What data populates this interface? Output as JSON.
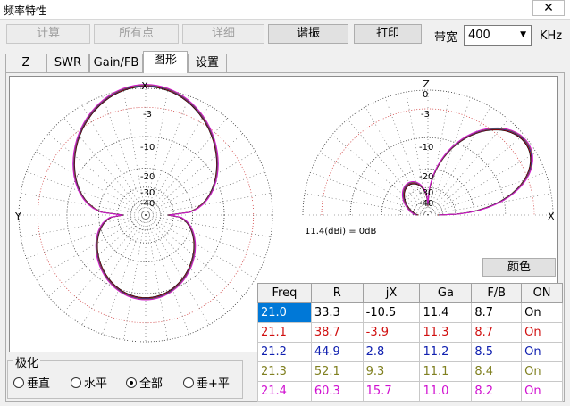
{
  "window": {
    "title": "频率特性",
    "close_glyph": "✕"
  },
  "toolbar": {
    "calc": "计算",
    "all_points": "所有点",
    "detail": "详细",
    "resonance": "谐振",
    "print": "打印",
    "bandwidth_label": "带宽",
    "bandwidth_value": "400",
    "unit": "KHz"
  },
  "tabs": [
    {
      "label": "Z"
    },
    {
      "label": "SWR"
    },
    {
      "label": "Gain/FB"
    },
    {
      "label": "图形",
      "active": true
    },
    {
      "label": "设置"
    }
  ],
  "plots": {
    "azimuth": {
      "top_label": "X",
      "left_label": "Y",
      "rings": [
        "-3",
        "-10",
        "-20",
        "-30",
        "-40"
      ]
    },
    "elevation": {
      "top_label": "Z",
      "right_label": "X",
      "rings": [
        "0",
        "-3",
        "-10",
        "-20",
        "-30",
        "-40"
      ],
      "gain_note": "11.4(dBi) = 0dB"
    }
  },
  "color_button": "颜色",
  "table": {
    "headers": [
      "Freq",
      "R",
      "jX",
      "Ga",
      "F/B",
      "ON"
    ],
    "rows": [
      {
        "freq": "21.0",
        "r": "33.3",
        "jx": "-10.5",
        "ga": "11.4",
        "fb": "8.7",
        "on": "On",
        "color": "#000000"
      },
      {
        "freq": "21.1",
        "r": "38.7",
        "jx": "-3.9",
        "ga": "11.3",
        "fb": "8.7",
        "on": "On",
        "color": "#d01010"
      },
      {
        "freq": "21.2",
        "r": "44.9",
        "jx": "2.8",
        "ga": "11.2",
        "fb": "8.5",
        "on": "On",
        "color": "#1020b0"
      },
      {
        "freq": "21.3",
        "r": "52.1",
        "jx": "9.3",
        "ga": "11.1",
        "fb": "8.4",
        "on": "On",
        "color": "#808020"
      },
      {
        "freq": "21.4",
        "r": "60.3",
        "jx": "15.7",
        "ga": "11.0",
        "fb": "8.2",
        "on": "On",
        "color": "#d010d0"
      }
    ]
  },
  "polarization": {
    "legend": "极化",
    "options": [
      "垂直",
      "水平",
      "全部",
      "垂+平"
    ],
    "selected": "全部"
  },
  "colors": {
    "trace_colors": [
      "#000000",
      "#d01010",
      "#1020b0",
      "#808020",
      "#d010d0"
    ],
    "selection": "#0078d7"
  }
}
